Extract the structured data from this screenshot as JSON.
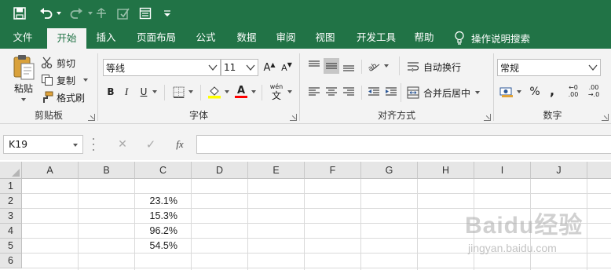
{
  "colors": {
    "brand": "#217346",
    "ribbon_bg": "#f3f3f3",
    "grid_line": "#dadada",
    "header_bg": "#e6e6e6"
  },
  "quick_access": {
    "icons": [
      "save-icon",
      "undo-icon",
      "redo-icon",
      "touch-mode-icon",
      "format-icon",
      "form-icon",
      "customize-icon"
    ]
  },
  "tabs": [
    {
      "label": "文件"
    },
    {
      "label": "开始"
    },
    {
      "label": "插入"
    },
    {
      "label": "页面布局"
    },
    {
      "label": "公式"
    },
    {
      "label": "数据"
    },
    {
      "label": "审阅"
    },
    {
      "label": "视图"
    },
    {
      "label": "开发工具"
    },
    {
      "label": "帮助"
    }
  ],
  "active_tab": "开始",
  "tell_me": "操作说明搜索",
  "ribbon": {
    "clipboard": {
      "label": "剪贴板",
      "paste": "粘贴",
      "cut": "剪切",
      "copy": "复制",
      "format_painter": "格式刷"
    },
    "font": {
      "label": "字体",
      "font_name": "等线",
      "font_size": "11",
      "grow": "A",
      "shrink": "A",
      "bold": "B",
      "italic": "I",
      "underline": "U",
      "font_color_letter": "A",
      "phonetic": "wén",
      "phonetic_char": "文"
    },
    "alignment": {
      "label": "对齐方式",
      "wrap_text": "自动换行",
      "merge_center": "合并后居中"
    },
    "number": {
      "label": "数字",
      "format": "常规",
      "percent": "%",
      "comma": ",",
      "inc_decimal_a": "←0",
      "inc_decimal_b": ".00",
      "dec_decimal_a": ".00",
      "dec_decimal_b": "→.0"
    }
  },
  "formula_bar": {
    "name_box": "K19",
    "cancel": "✕",
    "enter": "✓",
    "fx": "fx",
    "value": ""
  },
  "sheet": {
    "columns": [
      "A",
      "B",
      "C",
      "D",
      "E",
      "F",
      "G",
      "H",
      "I",
      "J"
    ],
    "rows": [
      "1",
      "2",
      "3",
      "4",
      "5",
      "6"
    ],
    "cells": {
      "C2": "23.1%",
      "C3": "15.3%",
      "C4": "96.2%",
      "C5": "54.5%"
    }
  },
  "watermark": {
    "text": "Baidu经验",
    "url_text": "jingyan.baidu.com"
  }
}
